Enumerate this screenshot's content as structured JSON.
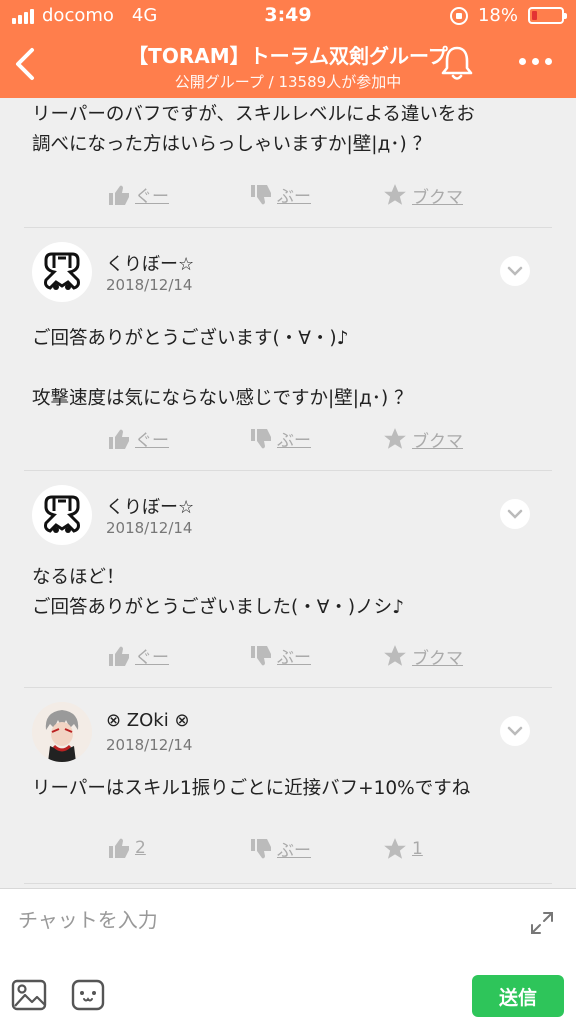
{
  "status_bar": {
    "carrier": "docomo",
    "network": "4G",
    "time": "3:49",
    "battery_percent": "18%",
    "battery_level": 0.18,
    "battery_color": "#e33333"
  },
  "header": {
    "title": "【TORAM】トーラム双剣グループ",
    "subtitle": "公開グループ / 13589人が参加中",
    "background_color": "#ff7e4c",
    "icons": [
      "back-chevron-icon",
      "bell-icon",
      "more-dots-icon"
    ]
  },
  "comments": [
    {
      "body": "リーパーのバフですが、スキルレベルによる違いをお\n調べになった方はいらっしゃいますか|壁|д･) ？",
      "like_label": "ぐー",
      "dislike_label": "ぶー",
      "bookmark_label": "ブクマ"
    },
    {
      "username": "くりぼー☆",
      "date": "2018/12/14",
      "body": "ご回答ありがとうございます(・∀・)♪\n\n攻撃速度は気にならない感じですか|壁|д･) ？",
      "like_label": "ぐー",
      "dislike_label": "ぶー",
      "bookmark_label": "ブクマ"
    },
    {
      "username": "くりぼー☆",
      "date": "2018/12/14",
      "body": "なるほど！\nご回答ありがとうございました(・∀・)ノシ♪",
      "like_label": "ぐー",
      "dislike_label": "ぶー",
      "bookmark_label": "ブクマ"
    },
    {
      "username": "⊗ ZOki ⊗",
      "date": "2018/12/14",
      "body": "リーパーはスキル1振りごとに近接バフ+10%ですね",
      "like_label": "2",
      "dislike_label": "ぶー",
      "bookmark_label": "1"
    }
  ],
  "chat_input": {
    "placeholder": "チャットを入力",
    "value": ""
  },
  "bottom_bar": {
    "send_label": "送信",
    "send_color": "#2ec55a"
  }
}
